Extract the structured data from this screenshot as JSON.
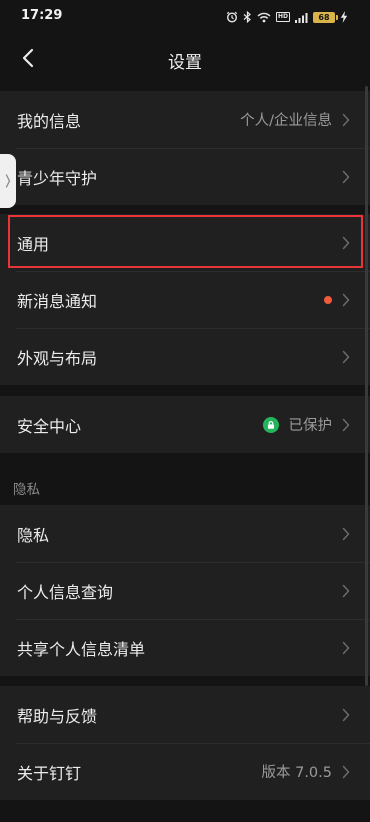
{
  "status_bar": {
    "time": "17:29",
    "battery_level": "68",
    "network_badge": "HD"
  },
  "nav": {
    "title": "设置"
  },
  "groups": {
    "account": {
      "my_info": {
        "label": "我的信息",
        "value": "个人/企业信息"
      },
      "youth_guard": {
        "label": "青少年守护"
      }
    },
    "general": {
      "general": {
        "label": "通用"
      },
      "notifications": {
        "label": "新消息通知",
        "has_red_dot": true
      },
      "appearance": {
        "label": "外观与布局"
      }
    },
    "security": {
      "security_center": {
        "label": "安全中心",
        "value": "已保护",
        "status_color": "#23b45c"
      }
    },
    "privacy": {
      "section_title": "隐私",
      "privacy": {
        "label": "隐私"
      },
      "personal_info_query": {
        "label": "个人信息查询"
      },
      "shared_info_list": {
        "label": "共享个人信息清单"
      }
    },
    "about": {
      "help_feedback": {
        "label": "帮助与反馈"
      },
      "about_dingtalk": {
        "label": "关于钉钉",
        "value": "版本 7.0.5"
      }
    }
  },
  "colors": {
    "background": "#141414",
    "card": "#202020",
    "highlight": "#e8353a",
    "notification_dot": "#f25a3c"
  }
}
